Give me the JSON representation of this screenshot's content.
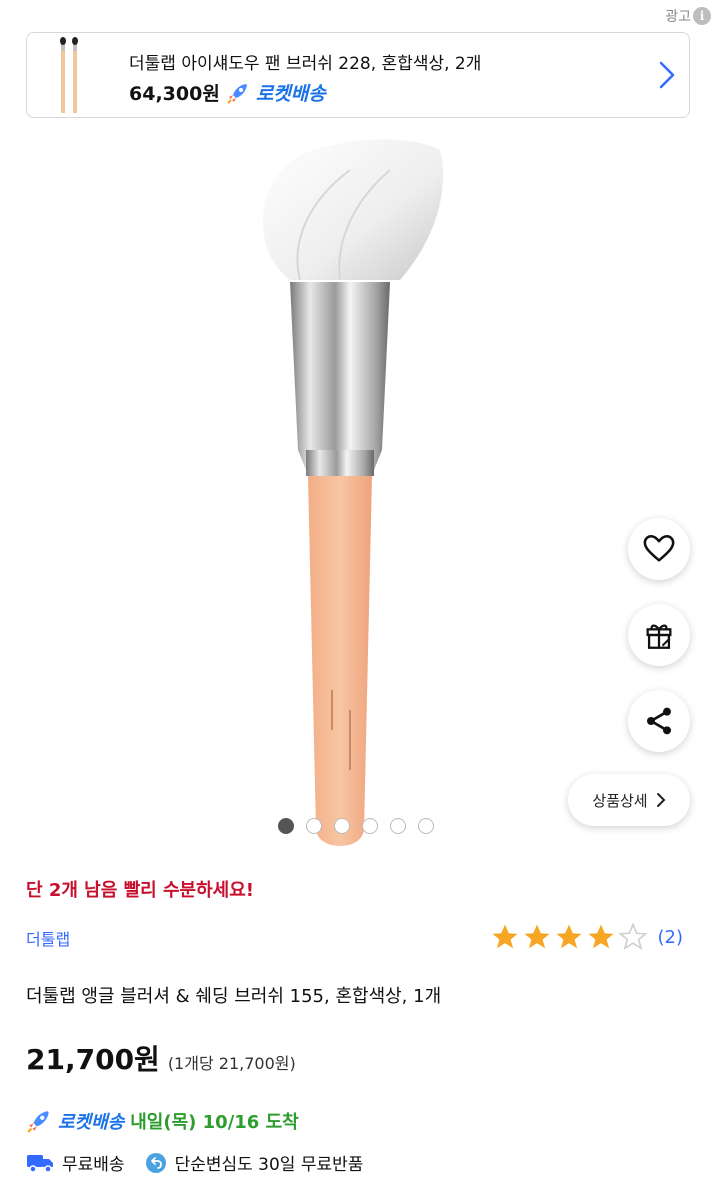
{
  "ad": {
    "label": "광고",
    "info_icon": "i",
    "title": "더툴랩 아이섀도우 팬 브러쉬 228, 혼합색상, 2개",
    "price": "64,300원",
    "badge": "로켓배송"
  },
  "side_actions": {
    "detail_label": "상품상세"
  },
  "gallery": {
    "image_count": 6,
    "active_index": 0
  },
  "product": {
    "stock_warning": "단 2개 남음 빨리 수분하세요!",
    "brand": "더툴랩",
    "rating_stars": 4,
    "rating_max": 5,
    "review_count": "(2)",
    "title": "더툴랩 앵글 블러셔 & 쉐딩 브러쉬 155, 혼합색상, 1개",
    "price": "21,700원",
    "unit_price": "(1개당 21,700원)"
  },
  "delivery": {
    "badge": "로켓배송",
    "date": "내일(목) 10/16 도착",
    "free_shipping": "무료배송",
    "free_return": "단순변심도 30일 무료반품"
  },
  "colors": {
    "accent_blue": "#346aff",
    "warning_red": "#c8102e",
    "delivery_green": "#2d9e2d",
    "star_orange": "#f5a623"
  }
}
